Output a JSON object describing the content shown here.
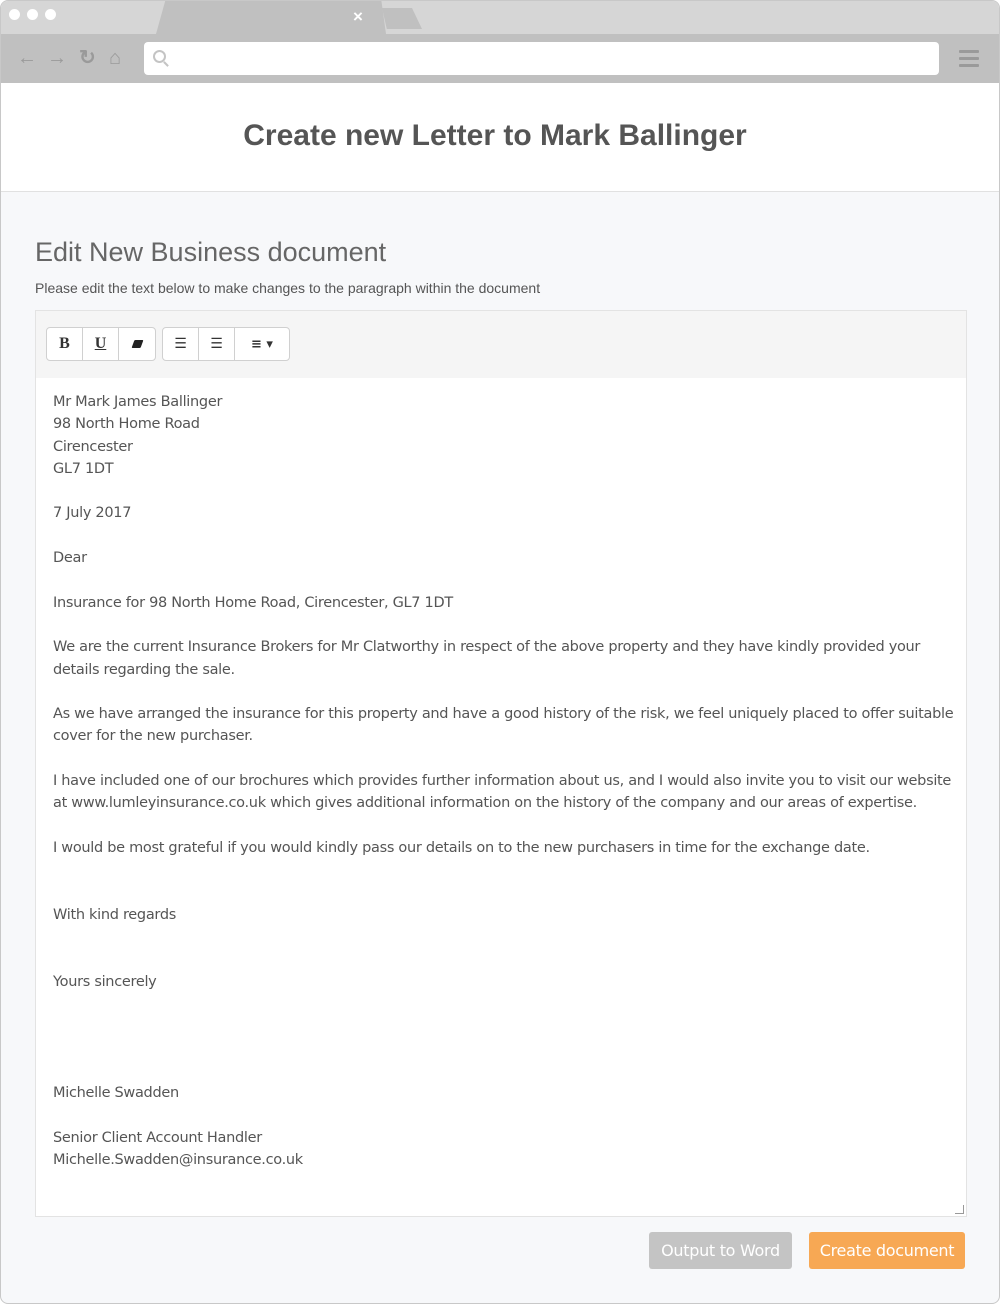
{
  "browser": {
    "tab_close": "×",
    "nav_icons": {
      "back": "←",
      "forward": "→",
      "reload": "↻",
      "home": "⌂"
    },
    "address_value": ""
  },
  "header": {
    "title": "Create new Letter to Mark Ballinger"
  },
  "section": {
    "title": "Edit New Business document",
    "description": "Please edit the text below to make changes to the paragraph within the document"
  },
  "toolbar": {
    "bold": "B",
    "underline": "U",
    "eraser": "eraser-icon",
    "bullet_list": "unordered-list-icon",
    "numbered_list": "ordered-list-icon",
    "align": "align-dropdown-icon"
  },
  "letter": {
    "name": "Mr Mark James Ballinger",
    "address1": "98 North Home Road",
    "address2": "Cirencester",
    "postcode": "GL7 1DT",
    "date": "7 July 2017",
    "salutation": "Dear",
    "subject": "Insurance for 98 North Home Road, Cirencester, GL7 1DT",
    "para1": "We are the current Insurance Brokers for Mr Clatworthy in respect of the above property and they have kindly provided your details regarding the sale.",
    "para2": "As we have arranged the insurance for this property and have a good history of the risk, we feel uniquely placed to offer suitable cover for the new purchaser.",
    "para3": "I have included one of our brochures which provides further information about us, and I would also invite you to visit our website at www.lumleyinsurance.co.uk which gives additional information on the history of the company and our areas of expertise.",
    "para4": "I would be most grateful if you would kindly pass our details on to the new purchasers in time for the exchange date.",
    "regards": "With kind regards",
    "closing": "Yours sincerely",
    "signer": "Michelle Swadden",
    "signer_title": "Senior Client Account Handler",
    "signer_email": "Michelle.Swadden@insurance.co.uk"
  },
  "actions": {
    "output_word": "Output to Word",
    "create_document": "Create document"
  },
  "colors": {
    "primary": "#f7a854",
    "secondary": "#c4c4c4"
  }
}
